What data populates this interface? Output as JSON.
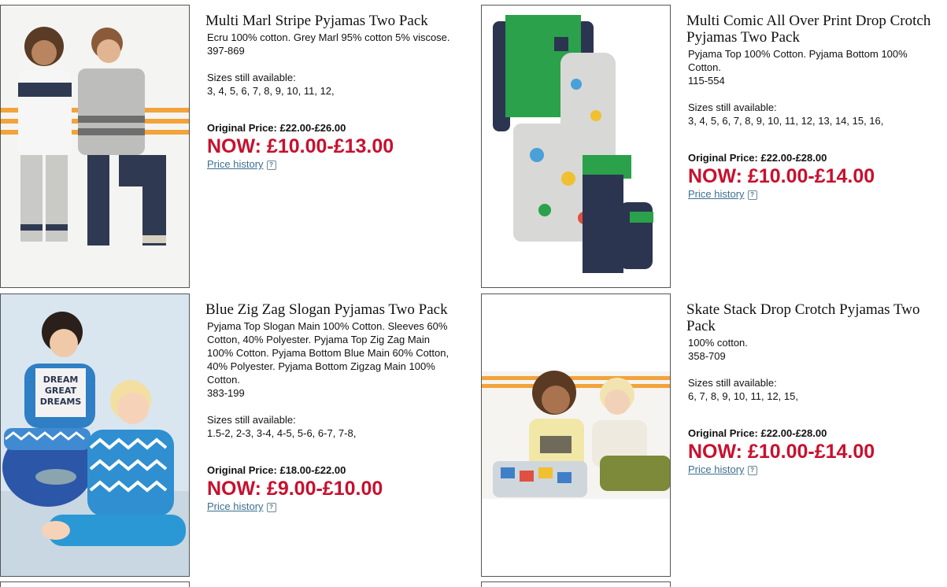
{
  "labels": {
    "sizes_label": "Sizes still available:",
    "price_history": "Price history",
    "price_history_icon": "info-icon"
  },
  "products": [
    {
      "title": "Multi Marl Stripe Pyjamas Two Pack",
      "description": "Ecru 100% cotton. Grey Marl 95% cotton 5% viscose.",
      "code": "397-869",
      "sizes": "3, 4, 5, 6, 7, 8, 9, 10, 11, 12,",
      "original_price": "Original Price: £22.00-£26.00",
      "now_price": "NOW: £10.00-£13.00"
    },
    {
      "title": "Multi Comic All Over Print Drop Crotch Pyjamas Two Pack",
      "description": "Pyjama Top 100% Cotton. Pyjama Bottom 100% Cotton.",
      "code": "115-554",
      "sizes": "3, 4, 5, 6, 7, 8, 9, 10, 11, 12, 13, 14, 15, 16,",
      "original_price": "Original Price: £22.00-£28.00",
      "now_price": "NOW: £10.00-£14.00"
    },
    {
      "title": "Blue Zig Zag Slogan Pyjamas Two Pack",
      "description": "Pyjama Top Slogan Main 100% Cotton. Sleeves 60% Cotton, 40% Polyester. Pyjama Top Zig Zag Main 100% Cotton. Pyjama Bottom Blue Main 60% Cotton, 40% Polyester. Pyjama Bottom Zigzag Main 100% Cotton.",
      "code": "383-199",
      "sizes": "1.5-2, 2-3, 3-4, 4-5, 5-6, 6-7, 7-8,",
      "original_price": "Original Price: £18.00-£22.00",
      "now_price": "NOW: £9.00-£10.00",
      "image_text": "DREAM GREAT DREAMS"
    },
    {
      "title": "Skate Stack Drop Crotch Pyjamas Two Pack",
      "description": "100% cotton.",
      "code": "358-709",
      "sizes": "6, 7, 8, 9, 10, 11, 12, 15,",
      "original_price": "Original Price: £22.00-£28.00",
      "now_price": "NOW: £10.00-£14.00"
    }
  ],
  "colors": {
    "now_price": "#c8102e",
    "link": "#3a6f8f",
    "border": "#555555"
  }
}
